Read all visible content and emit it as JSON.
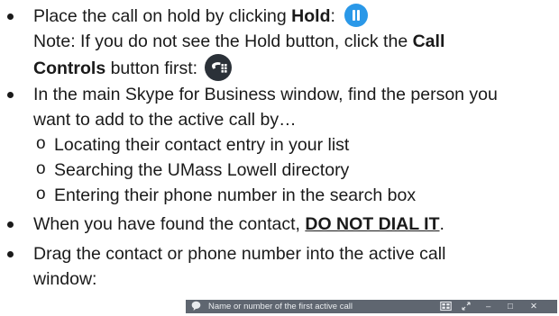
{
  "lines": [
    {
      "pre": "Place the call on hold by clicking ",
      "bold": "Hold",
      "post": ":"
    },
    {
      "text": "Note: If you do not see the Hold button, click the ",
      "bold": "Call"
    },
    {
      "bold": "Controls",
      "post": " button first:"
    },
    {
      "text": "In the main Skype for Business window, find the person you"
    },
    {
      "text": "want to add to the active call by…"
    },
    {
      "marker": "o",
      "text": "Locating their contact entry in your list"
    },
    {
      "marker": "o",
      "text": "Searching the UMass Lowell directory"
    },
    {
      "marker": "o",
      "text": "Entering their phone number in the search box"
    },
    {
      "pre": "When you have found the contact, ",
      "bold": "DO NOT DIAL IT",
      "post": "."
    },
    {
      "text": "Drag the contact or phone number into the active call"
    },
    {
      "text": "window:"
    }
  ],
  "call_window": {
    "title": "Name or number of the first active call",
    "icons": [
      "chat-icon",
      "layout-icon",
      "expand-icon",
      "minimize-icon",
      "maximize-icon",
      "close-icon"
    ],
    "minimize_glyph": "–",
    "maximize_glyph": "□",
    "close_glyph": "✕"
  },
  "colors": {
    "hold_button": "#2a98e8",
    "call_controls_button": "#2b3138",
    "call_bar": "#5f6670"
  }
}
